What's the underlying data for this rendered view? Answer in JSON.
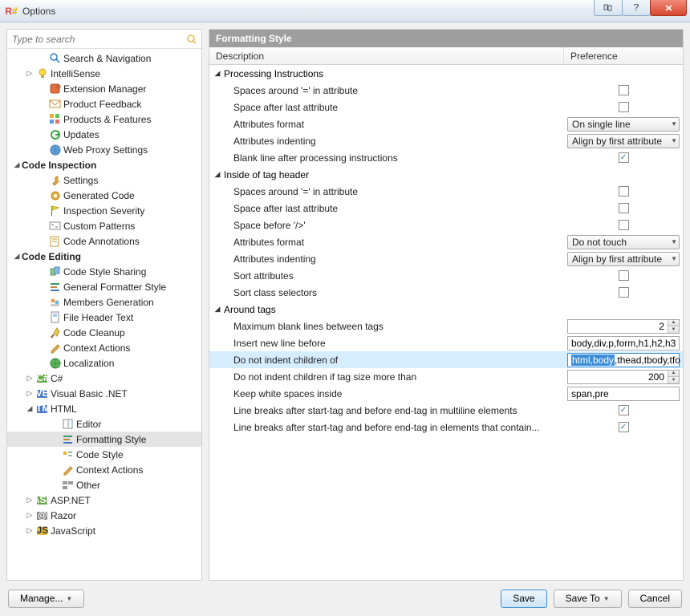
{
  "window": {
    "title": "Options"
  },
  "search": {
    "placeholder": "Type to search"
  },
  "left_tree": [
    {
      "depth": 2,
      "arrow": "none",
      "icon": "search-icon",
      "label": "Search & Navigation"
    },
    {
      "depth": 1,
      "arrow": "right",
      "icon": "bulb-icon",
      "label": "IntelliSense"
    },
    {
      "depth": 2,
      "arrow": "none",
      "icon": "puzzle-icon",
      "label": "Extension Manager"
    },
    {
      "depth": 2,
      "arrow": "none",
      "icon": "mail-icon",
      "label": "Product Feedback"
    },
    {
      "depth": 2,
      "arrow": "none",
      "icon": "grid-icon",
      "label": "Products & Features"
    },
    {
      "depth": 2,
      "arrow": "none",
      "icon": "refresh-icon",
      "label": "Updates"
    },
    {
      "depth": 2,
      "arrow": "none",
      "icon": "globe-icon",
      "label": "Web Proxy Settings"
    },
    {
      "depth": 0,
      "arrow": "down",
      "icon": "",
      "label": "Code Inspection",
      "bold": true
    },
    {
      "depth": 2,
      "arrow": "none",
      "icon": "wrench-icon",
      "label": "Settings"
    },
    {
      "depth": 2,
      "arrow": "none",
      "icon": "gear-icon",
      "label": "Generated Code"
    },
    {
      "depth": 2,
      "arrow": "none",
      "icon": "flag-icon",
      "label": "Inspection Severity"
    },
    {
      "depth": 2,
      "arrow": "none",
      "icon": "pattern-icon",
      "label": "Custom Patterns"
    },
    {
      "depth": 2,
      "arrow": "none",
      "icon": "note-icon",
      "label": "Code Annotations"
    },
    {
      "depth": 0,
      "arrow": "down",
      "icon": "",
      "label": "Code Editing",
      "bold": true
    },
    {
      "depth": 2,
      "arrow": "none",
      "icon": "share-icon",
      "label": "Code Style Sharing"
    },
    {
      "depth": 2,
      "arrow": "none",
      "icon": "format-icon",
      "label": "General Formatter Style"
    },
    {
      "depth": 2,
      "arrow": "none",
      "icon": "members-icon",
      "label": "Members Generation"
    },
    {
      "depth": 2,
      "arrow": "none",
      "icon": "file-icon",
      "label": "File Header Text"
    },
    {
      "depth": 2,
      "arrow": "none",
      "icon": "broom-icon",
      "label": "Code Cleanup"
    },
    {
      "depth": 2,
      "arrow": "none",
      "icon": "pencil-icon",
      "label": "Context Actions"
    },
    {
      "depth": 2,
      "arrow": "none",
      "icon": "globe2-icon",
      "label": "Localization"
    },
    {
      "depth": 1,
      "arrow": "right",
      "icon": "cs-icon",
      "label": "C#"
    },
    {
      "depth": 1,
      "arrow": "right",
      "icon": "vb-icon",
      "label": "Visual Basic .NET"
    },
    {
      "depth": 1,
      "arrow": "down",
      "icon": "html-icon",
      "label": "HTML"
    },
    {
      "depth": 3,
      "arrow": "none",
      "icon": "editor-icon",
      "label": "Editor"
    },
    {
      "depth": 3,
      "arrow": "none",
      "icon": "format-icon",
      "label": "Formatting Style",
      "selected": true
    },
    {
      "depth": 3,
      "arrow": "none",
      "icon": "style-icon",
      "label": "Code Style"
    },
    {
      "depth": 3,
      "arrow": "none",
      "icon": "pencil-icon",
      "label": "Context Actions"
    },
    {
      "depth": 3,
      "arrow": "none",
      "icon": "other-icon",
      "label": "Other"
    },
    {
      "depth": 1,
      "arrow": "right",
      "icon": "asp-icon",
      "label": "ASP.NET"
    },
    {
      "depth": 1,
      "arrow": "right",
      "icon": "razor-icon",
      "label": "Razor"
    },
    {
      "depth": 1,
      "arrow": "right",
      "icon": "js-icon",
      "label": "JavaScript"
    }
  ],
  "pane": {
    "title": "Formatting Style",
    "columns": {
      "description": "Description",
      "preference": "Preference"
    }
  },
  "settings": [
    {
      "type": "group",
      "label": "Processing Instructions"
    },
    {
      "type": "item",
      "label": "Spaces around '=' in attribute",
      "control": "checkbox",
      "value": false
    },
    {
      "type": "item",
      "label": "Space after last attribute",
      "control": "checkbox",
      "value": false
    },
    {
      "type": "item",
      "label": "Attributes format",
      "control": "combo",
      "value": "On single line"
    },
    {
      "type": "item",
      "label": "Attributes indenting",
      "control": "combo",
      "value": "Align by first attribute"
    },
    {
      "type": "item",
      "label": "Blank line after processing instructions",
      "control": "checkbox",
      "value": true
    },
    {
      "type": "group",
      "label": "Inside of tag header"
    },
    {
      "type": "item",
      "label": "Spaces around '=' in attribute",
      "control": "checkbox",
      "value": false
    },
    {
      "type": "item",
      "label": "Space after last attribute",
      "control": "checkbox",
      "value": false
    },
    {
      "type": "item",
      "label": "Space before '/>'",
      "control": "checkbox",
      "value": false
    },
    {
      "type": "item",
      "label": "Attributes format",
      "control": "combo",
      "value": "Do not touch"
    },
    {
      "type": "item",
      "label": "Attributes indenting",
      "control": "combo",
      "value": "Align by first attribute"
    },
    {
      "type": "item",
      "label": "Sort attributes",
      "control": "checkbox",
      "value": false
    },
    {
      "type": "item",
      "label": "Sort class selectors",
      "control": "checkbox",
      "value": false
    },
    {
      "type": "group",
      "label": "Around tags"
    },
    {
      "type": "item",
      "label": "Maximum blank lines between tags",
      "control": "number",
      "value": "2"
    },
    {
      "type": "item",
      "label": "Insert new line before",
      "control": "text",
      "value": "body,div,p,form,h1,h2,h3"
    },
    {
      "type": "item",
      "label": "Do not indent children of",
      "control": "text",
      "value_sel": "html,body",
      "value_rest": ",thead,tbody,tfo",
      "highlight": true
    },
    {
      "type": "item",
      "label": "Do not indent children if tag size more than",
      "control": "number",
      "value": "200"
    },
    {
      "type": "item",
      "label": "Keep white spaces inside",
      "control": "text",
      "value": "span,pre"
    },
    {
      "type": "item",
      "label": "Line breaks after start-tag and before end-tag in multiline elements",
      "control": "checkbox",
      "value": true
    },
    {
      "type": "item",
      "label": "Line breaks after start-tag and before end-tag in elements that contain...",
      "control": "checkbox",
      "value": true
    }
  ],
  "footer": {
    "manage": "Manage...",
    "save": "Save",
    "save_to": "Save To",
    "cancel": "Cancel"
  }
}
